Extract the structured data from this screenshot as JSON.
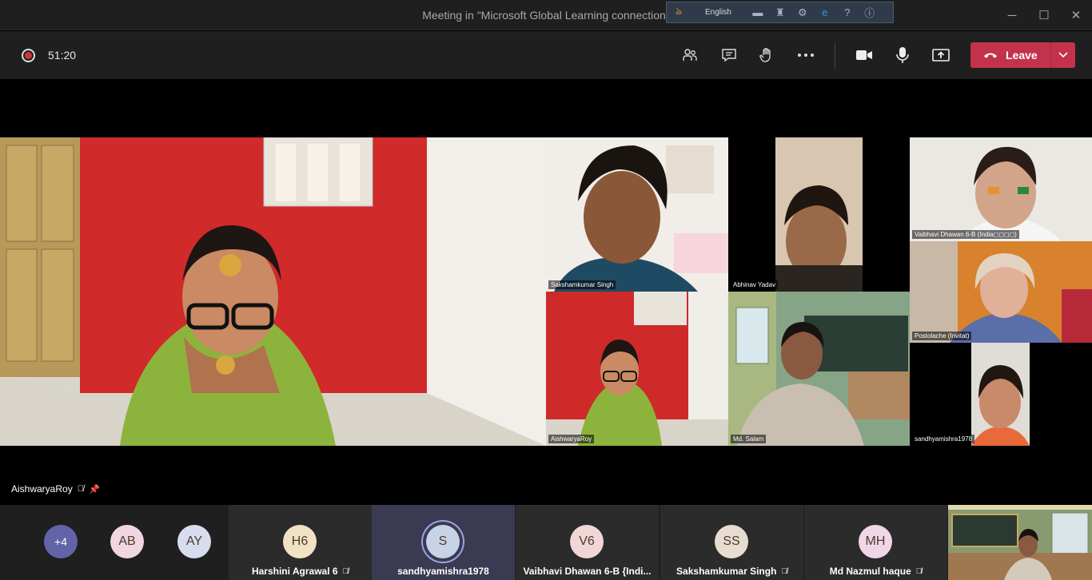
{
  "window": {
    "title": "Meeting in \"Microsoft Global Learning connection\"",
    "lang_bar": {
      "language": "English"
    }
  },
  "toolbar": {
    "timer": "51:20",
    "leave_label": "Leave"
  },
  "videos": {
    "main_speaker": "AishwaryaRoy",
    "tiles": [
      {
        "name": "Sakshamkumar Singh"
      },
      {
        "name": "Abhinav Yadav"
      },
      {
        "name": "Vaibhavi Dhawan 6-B (India◻◻◻◻)"
      },
      {
        "name": "Postolache (Invitat)"
      },
      {
        "name": "AishwaryaRoy"
      },
      {
        "name": "Md. Salam"
      },
      {
        "name": "sandhyamishra1978"
      }
    ]
  },
  "participants": {
    "overflow": "+4",
    "avatars": [
      {
        "initials": "AB"
      },
      {
        "initials": "AY"
      }
    ],
    "tiles": [
      {
        "initials": "H6",
        "name": "Harshini Agrawal 6",
        "color": "#f2e2c4"
      },
      {
        "initials": "S",
        "name": "sandhyamishra1978",
        "color": "#c9d3e8"
      },
      {
        "initials": "V6",
        "name": "Vaibhavi Dhawan 6-B {Indi...",
        "color": "#f0d6d6"
      },
      {
        "initials": "SS",
        "name": "Sakshamkumar Singh",
        "color": "#e8dcd0"
      },
      {
        "initials": "MH",
        "name": "Md Nazmul haque",
        "color": "#f0d6e6"
      }
    ]
  }
}
